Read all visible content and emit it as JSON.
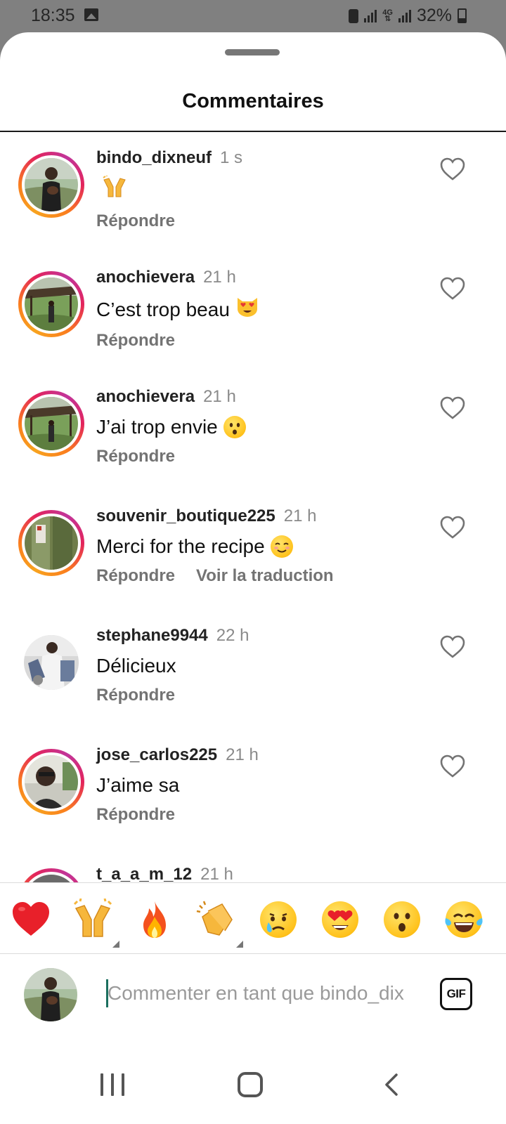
{
  "status_bar": {
    "time": "18:35",
    "battery": "32%",
    "network": "4G",
    "icons": [
      "image-icon",
      "battery-saver-icon",
      "signal-icon",
      "4g-icon",
      "signal-icon",
      "battery-icon"
    ]
  },
  "sheet": {
    "title": "Commentaires"
  },
  "comments": [
    {
      "username": "bindo_dixneuf",
      "time": "1 s",
      "text": "",
      "emoji": "raising-hands",
      "actions": [
        "Répondre"
      ],
      "story_ring": true
    },
    {
      "username": "anochievera",
      "time": "21 h",
      "text": "C’est trop beau",
      "emoji": "heart-eyes-cat",
      "actions": [
        "Répondre"
      ],
      "story_ring": true
    },
    {
      "username": "anochievera",
      "time": "21 h",
      "text": "J’ai trop envie",
      "emoji": "hushed-face",
      "actions": [
        "Répondre"
      ],
      "story_ring": true
    },
    {
      "username": "souvenir_boutique225",
      "time": "21 h",
      "text": "Merci for the recipe",
      "emoji": "smiling-face",
      "actions": [
        "Répondre",
        "Voir la traduction"
      ],
      "story_ring": true
    },
    {
      "username": "stephane9944",
      "time": "22 h",
      "text": "Délicieux",
      "emoji": "",
      "actions": [
        "Répondre"
      ],
      "story_ring": false
    },
    {
      "username": "jose_carlos225",
      "time": "21 h",
      "text": "J’aime sa",
      "emoji": "",
      "actions": [
        "Répondre"
      ],
      "story_ring": true
    },
    {
      "username": "t_a_a_m_12",
      "time": "21 h",
      "text": "",
      "emoji": "",
      "actions": [],
      "story_ring": true
    }
  ],
  "reactions": [
    "red-heart",
    "raising-hands",
    "fire",
    "clapping-hands",
    "crying-face",
    "heart-eyes",
    "hushed-face",
    "tears-of-joy"
  ],
  "composer": {
    "placeholder": "Commenter en tant que bindo_dix",
    "gif_label": "GIF"
  },
  "colors": {
    "story_ring_start": "#f8a31f",
    "story_ring_end": "#c1359a",
    "muted_text": "#737373",
    "cursor": "#1b6f5f"
  }
}
